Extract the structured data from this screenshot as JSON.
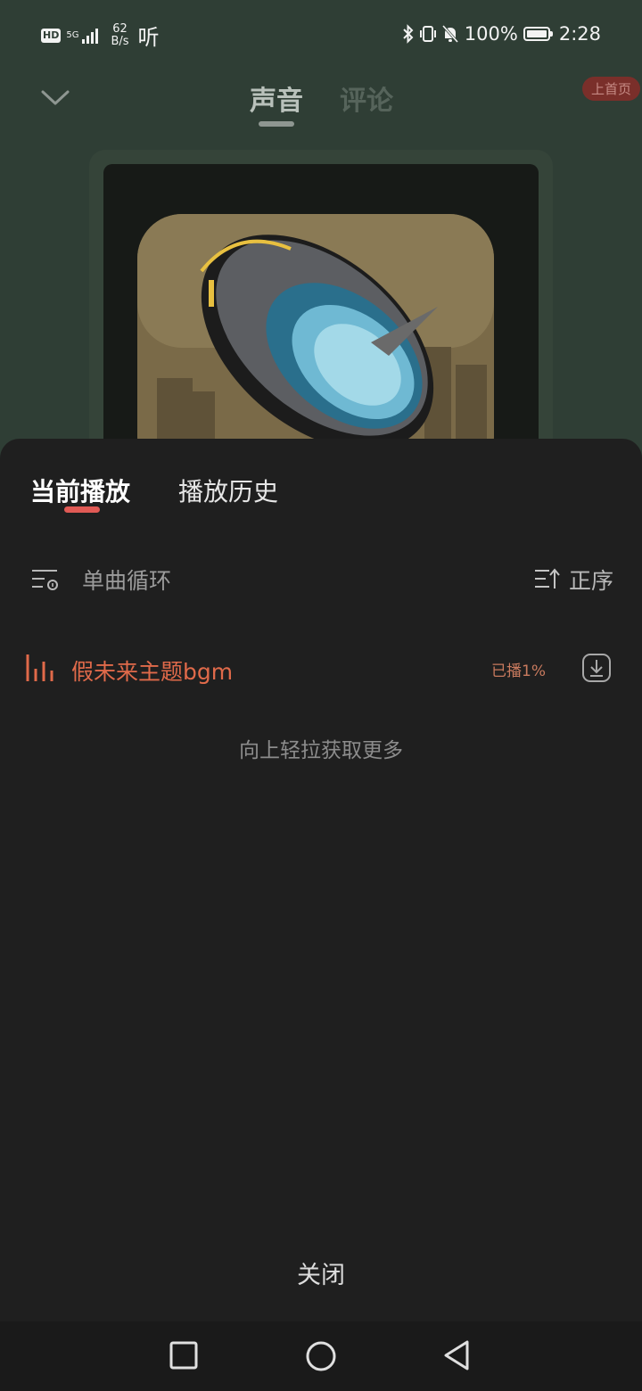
{
  "status_bar": {
    "hd_label": "HD",
    "network_type": "5G",
    "speed_value": "62",
    "speed_unit": "B/s",
    "app_indicator": "听",
    "battery_percent": "100%",
    "time": "2:28"
  },
  "header": {
    "tabs": [
      {
        "label": "声音",
        "active": true
      },
      {
        "label": "评论",
        "active": false
      }
    ],
    "home_badge": "上首页"
  },
  "sheet": {
    "tabs": [
      {
        "label": "当前播放",
        "active": true
      },
      {
        "label": "播放历史",
        "active": false
      }
    ],
    "loop_mode_label": "单曲循环",
    "order_label": "正序",
    "tracks": [
      {
        "title": "假未来主题bgm",
        "played": "已播1%",
        "playing": true
      }
    ],
    "pull_hint": "向上轻拉获取更多",
    "close_label": "关闭"
  },
  "colors": {
    "accent": "#e05a55",
    "playing_track": "#e06a4a",
    "sheet_bg": "#1f1f1f",
    "page_bg": "#2f3e35"
  },
  "icons": {
    "collapse": "chevron-down-icon",
    "loop": "repeat-one-icon",
    "sort": "sort-ascending-icon",
    "playing": "equalizer-icon",
    "download": "download-icon",
    "nav_recent": "square-icon",
    "nav_home": "circle-icon",
    "nav_back": "triangle-back-icon"
  }
}
